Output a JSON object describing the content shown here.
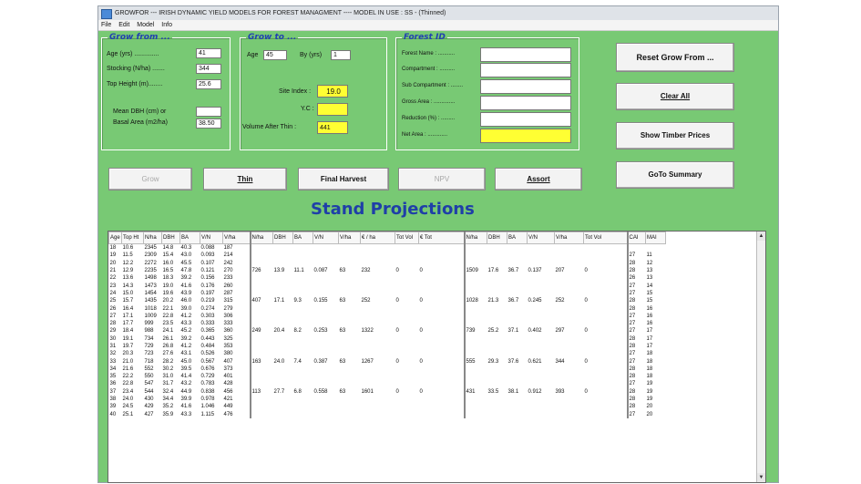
{
  "title": "GROWFOR --- IRISH DYNAMIC YIELD MODELS FOR FOREST MANAGMENT ---- MODEL IN USE : SS - (Thinned)",
  "menu": [
    "File",
    "Edit",
    "Model",
    "Info"
  ],
  "grow_from": {
    "legend": "Grow from ...",
    "age_label": "Age (yrs) ..............",
    "age": "41",
    "stocking_label": "Stocking (N/ha) .......",
    "stocking": "344",
    "top_height_label": "Top Height (m)........",
    "top_height": "25.6",
    "mean_dbh_label": "Mean DBH (cm) or",
    "basal_label": "Basal Area (m2/ha)",
    "basal": "38.50"
  },
  "grow_to": {
    "legend": "Grow to ...",
    "age_label": "Age",
    "age": "45",
    "by_label": "By (yrs)",
    "by": "1",
    "site_index_label": "Site Index :",
    "site_index": "19.0",
    "yc_label": "Y.C :",
    "vol_after_label": "Volume After Thin :",
    "vol_after": "441"
  },
  "forest_id": {
    "legend": "Forest ID",
    "labels": [
      "Forest Name : ...........",
      "Compartment : ..........",
      "Sub Compartment : ........",
      "Gross Area : ..............",
      "Reduction (%) : .........",
      "Net Area : ............."
    ]
  },
  "buttons": {
    "reset": "Reset Grow From ...",
    "clear": "Clear All",
    "prices": "Show Timber Prices",
    "summary": "GoTo Summary",
    "grow": "Grow",
    "thin": "Thin",
    "final": "Final Harvest",
    "npv": "NPV",
    "assort": "Assort"
  },
  "heading": "Stand Projections",
  "table": {
    "headers": [
      "Age",
      "Top Ht",
      "N/ha",
      "DBH",
      "BA",
      "V/N",
      "V/ha",
      "N/ha",
      "DBH",
      "BA",
      "V/N",
      "V/ha",
      "€ / ha",
      "Tot Vol",
      "€ Tot",
      "N/ha",
      "DBH",
      "BA",
      "V/N",
      "V/ha",
      "Tot Vol",
      "CAI",
      "MAI"
    ],
    "rows": [
      [
        "18",
        "10.6",
        "2345",
        "14.8",
        "40.3",
        "0.088",
        "187",
        "",
        "",
        "",
        "",
        "",
        "",
        "",
        "",
        "",
        "",
        "",
        "",
        "",
        "",
        "",
        ""
      ],
      [
        "19",
        "11.5",
        "2309",
        "15.4",
        "43.0",
        "0.093",
        "214",
        "",
        "",
        "",
        "",
        "",
        "",
        "",
        "",
        "",
        "",
        "",
        "",
        "",
        "",
        "27",
        "11"
      ],
      [
        "20",
        "12.2",
        "2272",
        "16.0",
        "45.5",
        "0.107",
        "242",
        "",
        "",
        "",
        "",
        "",
        "",
        "",
        "",
        "",
        "",
        "",
        "",
        "",
        "",
        "28",
        "12"
      ],
      [
        "21",
        "12.9",
        "2235",
        "16.5",
        "47.8",
        "0.121",
        "270",
        "726",
        "13.9",
        "11.1",
        "0.087",
        "63",
        "232",
        "0",
        "0",
        "1509",
        "17.6",
        "36.7",
        "0.137",
        "207",
        "0",
        "28",
        "13"
      ],
      [
        "22",
        "13.6",
        "1498",
        "18.3",
        "39.2",
        "0.156",
        "233",
        "",
        "",
        "",
        "",
        "",
        "",
        "",
        "",
        "",
        "",
        "",
        "",
        "",
        "",
        "26",
        "13"
      ],
      [
        "23",
        "14.3",
        "1473",
        "19.0",
        "41.6",
        "0.176",
        "260",
        "",
        "",
        "",
        "",
        "",
        "",
        "",
        "",
        "",
        "",
        "",
        "",
        "",
        "",
        "27",
        "14"
      ],
      [
        "24",
        "15.0",
        "1454",
        "19.6",
        "43.9",
        "0.197",
        "287",
        "",
        "",
        "",
        "",
        "",
        "",
        "",
        "",
        "",
        "",
        "",
        "",
        "",
        "",
        "27",
        "15"
      ],
      [
        "25",
        "15.7",
        "1435",
        "20.2",
        "46.0",
        "0.219",
        "315",
        "407",
        "17.1",
        "9.3",
        "0.155",
        "63",
        "252",
        "0",
        "0",
        "1028",
        "21.3",
        "36.7",
        "0.245",
        "252",
        "0",
        "28",
        "15"
      ],
      [
        "26",
        "16.4",
        "1018",
        "22.1",
        "39.0",
        "0.274",
        "279",
        "",
        "",
        "",
        "",
        "",
        "",
        "",
        "",
        "",
        "",
        "",
        "",
        "",
        "",
        "28",
        "16"
      ],
      [
        "27",
        "17.1",
        "1009",
        "22.8",
        "41.2",
        "0.303",
        "306",
        "",
        "",
        "",
        "",
        "",
        "",
        "",
        "",
        "",
        "",
        "",
        "",
        "",
        "",
        "27",
        "16"
      ],
      [
        "28",
        "17.7",
        "999",
        "23.5",
        "43.3",
        "0.333",
        "333",
        "",
        "",
        "",
        "",
        "",
        "",
        "",
        "",
        "",
        "",
        "",
        "",
        "",
        "",
        "27",
        "16"
      ],
      [
        "29",
        "18.4",
        "988",
        "24.1",
        "45.2",
        "0.365",
        "360",
        "249",
        "20.4",
        "8.2",
        "0.253",
        "63",
        "1322",
        "0",
        "0",
        "739",
        "25.2",
        "37.1",
        "0.402",
        "297",
        "0",
        "27",
        "17"
      ],
      [
        "30",
        "19.1",
        "734",
        "26.1",
        "39.2",
        "0.443",
        "325",
        "",
        "",
        "",
        "",
        "",
        "",
        "",
        "",
        "",
        "",
        "",
        "",
        "",
        "",
        "28",
        "17"
      ],
      [
        "31",
        "19.7",
        "729",
        "26.8",
        "41.2",
        "0.484",
        "353",
        "",
        "",
        "",
        "",
        "",
        "",
        "",
        "",
        "",
        "",
        "",
        "",
        "",
        "",
        "28",
        "17"
      ],
      [
        "32",
        "20.3",
        "723",
        "27.6",
        "43.1",
        "0.526",
        "380",
        "",
        "",
        "",
        "",
        "",
        "",
        "",
        "",
        "",
        "",
        "",
        "",
        "",
        "",
        "27",
        "18"
      ],
      [
        "33",
        "21.0",
        "718",
        "28.2",
        "45.0",
        "0.567",
        "407",
        "163",
        "24.0",
        "7.4",
        "0.387",
        "63",
        "1267",
        "0",
        "0",
        "555",
        "29.3",
        "37.6",
        "0.621",
        "344",
        "0",
        "27",
        "18"
      ],
      [
        "34",
        "21.6",
        "552",
        "30.2",
        "39.5",
        "0.676",
        "373",
        "",
        "",
        "",
        "",
        "",
        "",
        "",
        "",
        "",
        "",
        "",
        "",
        "",
        "",
        "28",
        "18"
      ],
      [
        "35",
        "22.2",
        "550",
        "31.0",
        "41.4",
        "0.729",
        "401",
        "",
        "",
        "",
        "",
        "",
        "",
        "",
        "",
        "",
        "",
        "",
        "",
        "",
        "",
        "28",
        "18"
      ],
      [
        "36",
        "22.8",
        "547",
        "31.7",
        "43.2",
        "0.783",
        "428",
        "",
        "",
        "",
        "",
        "",
        "",
        "",
        "",
        "",
        "",
        "",
        "",
        "",
        "",
        "27",
        "19"
      ],
      [
        "37",
        "23.4",
        "544",
        "32.4",
        "44.9",
        "0.838",
        "456",
        "113",
        "27.7",
        "6.8",
        "0.558",
        "63",
        "1601",
        "0",
        "0",
        "431",
        "33.5",
        "38.1",
        "0.912",
        "393",
        "0",
        "28",
        "19"
      ],
      [
        "38",
        "24.0",
        "430",
        "34.4",
        "39.9",
        "0.978",
        "421",
        "",
        "",
        "",
        "",
        "",
        "",
        "",
        "",
        "",
        "",
        "",
        "",
        "",
        "",
        "28",
        "19"
      ],
      [
        "39",
        "24.5",
        "429",
        "35.2",
        "41.6",
        "1.046",
        "449",
        "",
        "",
        "",
        "",
        "",
        "",
        "",
        "",
        "",
        "",
        "",
        "",
        "",
        "",
        "28",
        "20"
      ],
      [
        "40",
        "25.1",
        "427",
        "35.9",
        "43.3",
        "1.115",
        "476",
        "",
        "",
        "",
        "",
        "",
        "",
        "",
        "",
        "",
        "",
        "",
        "",
        "",
        "",
        "27",
        "20"
      ]
    ]
  }
}
